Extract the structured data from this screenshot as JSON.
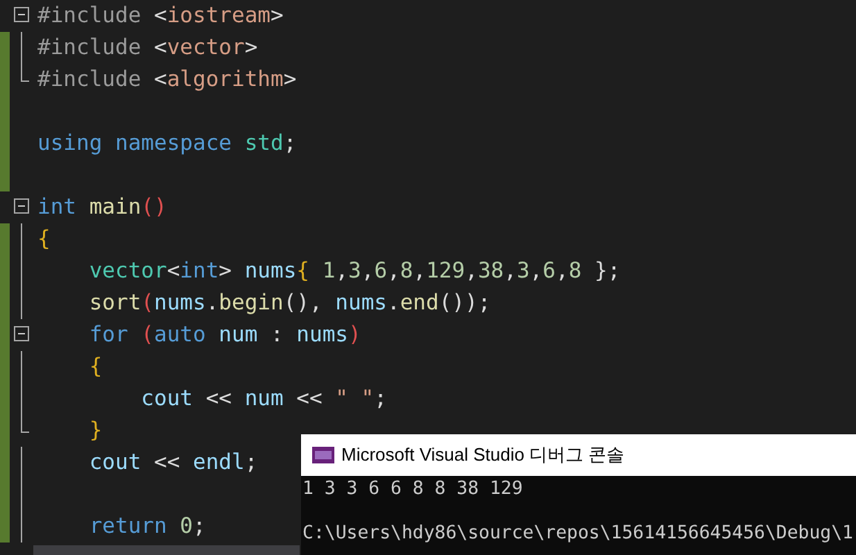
{
  "editor": {
    "lines": [
      {
        "changed": false,
        "gutter": {
          "kind": "box"
        },
        "tokens": [
          {
            "text": "#include ",
            "kind": "pre"
          },
          {
            "text": "<",
            "kind": "punct"
          },
          {
            "text": "iostream",
            "kind": "str"
          },
          {
            "text": ">",
            "kind": "punct"
          }
        ]
      },
      {
        "changed": true,
        "gutter": {
          "kind": "guide"
        },
        "tokens": [
          {
            "text": "#include ",
            "kind": "pre"
          },
          {
            "text": "<",
            "kind": "punct"
          },
          {
            "text": "vector",
            "kind": "str"
          },
          {
            "text": ">",
            "kind": "punct"
          }
        ]
      },
      {
        "changed": true,
        "gutter": {
          "kind": "guide_end"
        },
        "tokens": [
          {
            "text": "#include ",
            "kind": "pre"
          },
          {
            "text": "<",
            "kind": "punct"
          },
          {
            "text": "algorithm",
            "kind": "str"
          },
          {
            "text": ">",
            "kind": "punct"
          }
        ]
      },
      {
        "changed": true
      },
      {
        "changed": true,
        "tokens": [
          {
            "text": "using namespace ",
            "kind": "kw"
          },
          {
            "text": "std",
            "kind": "type"
          },
          {
            "text": ";",
            "kind": "punct"
          }
        ]
      },
      {
        "changed": true
      },
      {
        "changed": false,
        "gutter": {
          "kind": "box"
        },
        "tokens": [
          {
            "text": "int ",
            "kind": "kw"
          },
          {
            "text": "main",
            "kind": "fn"
          },
          {
            "text": "()",
            "kind": "paren"
          }
        ]
      },
      {
        "changed": true,
        "gutter": {
          "kind": "guide"
        },
        "tokens": [
          {
            "text": "{",
            "kind": "brace"
          }
        ]
      },
      {
        "changed": true,
        "gutter": {
          "kind": "guide"
        },
        "tokens": [
          {
            "text": "    vector",
            "kind": "type"
          },
          {
            "text": "<",
            "kind": "punct"
          },
          {
            "text": "int",
            "kind": "kw"
          },
          {
            "text": "> ",
            "kind": "punct"
          },
          {
            "text": "nums",
            "kind": "var"
          },
          {
            "text": "{ ",
            "kind": "brace"
          },
          {
            "text": "1",
            "kind": "num"
          },
          {
            "text": ",",
            "kind": "punct"
          },
          {
            "text": "3",
            "kind": "num"
          },
          {
            "text": ",",
            "kind": "punct"
          },
          {
            "text": "6",
            "kind": "num"
          },
          {
            "text": ",",
            "kind": "punct"
          },
          {
            "text": "8",
            "kind": "num"
          },
          {
            "text": ",",
            "kind": "punct"
          },
          {
            "text": "129",
            "kind": "num"
          },
          {
            "text": ",",
            "kind": "punct"
          },
          {
            "text": "38",
            "kind": "num"
          },
          {
            "text": ",",
            "kind": "punct"
          },
          {
            "text": "3",
            "kind": "num"
          },
          {
            "text": ",",
            "kind": "punct"
          },
          {
            "text": "6",
            "kind": "num"
          },
          {
            "text": ",",
            "kind": "punct"
          },
          {
            "text": "8",
            "kind": "num"
          },
          {
            "text": " };",
            "kind": "punct"
          }
        ]
      },
      {
        "changed": true,
        "gutter": {
          "kind": "guide"
        },
        "tokens": [
          {
            "text": "    sort",
            "kind": "fn"
          },
          {
            "text": "(",
            "kind": "paren"
          },
          {
            "text": "nums",
            "kind": "var"
          },
          {
            "text": ".",
            "kind": "punct"
          },
          {
            "text": "begin",
            "kind": "fn"
          },
          {
            "text": "(), ",
            "kind": "punct"
          },
          {
            "text": "nums",
            "kind": "var"
          },
          {
            "text": ".",
            "kind": "punct"
          },
          {
            "text": "end",
            "kind": "fn"
          },
          {
            "text": "());",
            "kind": "punct"
          }
        ]
      },
      {
        "changed": true,
        "gutter": {
          "kind": "box"
        },
        "tokens": [
          {
            "text": "    for ",
            "kind": "kw"
          },
          {
            "text": "(",
            "kind": "paren"
          },
          {
            "text": "auto ",
            "kind": "kw"
          },
          {
            "text": "num",
            "kind": "var"
          },
          {
            "text": " : ",
            "kind": "punct"
          },
          {
            "text": "nums",
            "kind": "var"
          },
          {
            "text": ")",
            "kind": "paren"
          }
        ]
      },
      {
        "changed": true,
        "gutter": {
          "kind": "guide"
        },
        "tokens": [
          {
            "text": "    {",
            "kind": "brace"
          }
        ]
      },
      {
        "changed": true,
        "gutter": {
          "kind": "guide"
        },
        "tokens": [
          {
            "text": "        cout",
            "kind": "var"
          },
          {
            "text": " << ",
            "kind": "punct"
          },
          {
            "text": "num",
            "kind": "var"
          },
          {
            "text": " << ",
            "kind": "punct"
          },
          {
            "text": "\" \"",
            "kind": "str"
          },
          {
            "text": ";",
            "kind": "punct"
          }
        ]
      },
      {
        "changed": true,
        "gutter": {
          "kind": "guide_end"
        },
        "tokens": [
          {
            "text": "    }",
            "kind": "brace"
          }
        ]
      },
      {
        "changed": true,
        "gutter": {
          "kind": "guide"
        },
        "tokens": [
          {
            "text": "    cout",
            "kind": "var"
          },
          {
            "text": " << ",
            "kind": "punct"
          },
          {
            "text": "endl",
            "kind": "var"
          },
          {
            "text": ";",
            "kind": "punct"
          }
        ]
      },
      {
        "changed": true,
        "gutter": {
          "kind": "guide"
        }
      },
      {
        "changed": true,
        "gutter": {
          "kind": "guide"
        },
        "tokens": [
          {
            "text": "    return ",
            "kind": "kw"
          },
          {
            "text": "0",
            "kind": "num"
          },
          {
            "text": ";",
            "kind": "punct"
          }
        ]
      }
    ]
  },
  "console": {
    "title": "Microsoft Visual Studio 디버그 콘솔",
    "lines": [
      "1 3 3 6 6 8 8 38 129",
      "C:\\Users\\hdy86\\source\\repos\\15614156645456\\Debug\\1"
    ]
  }
}
